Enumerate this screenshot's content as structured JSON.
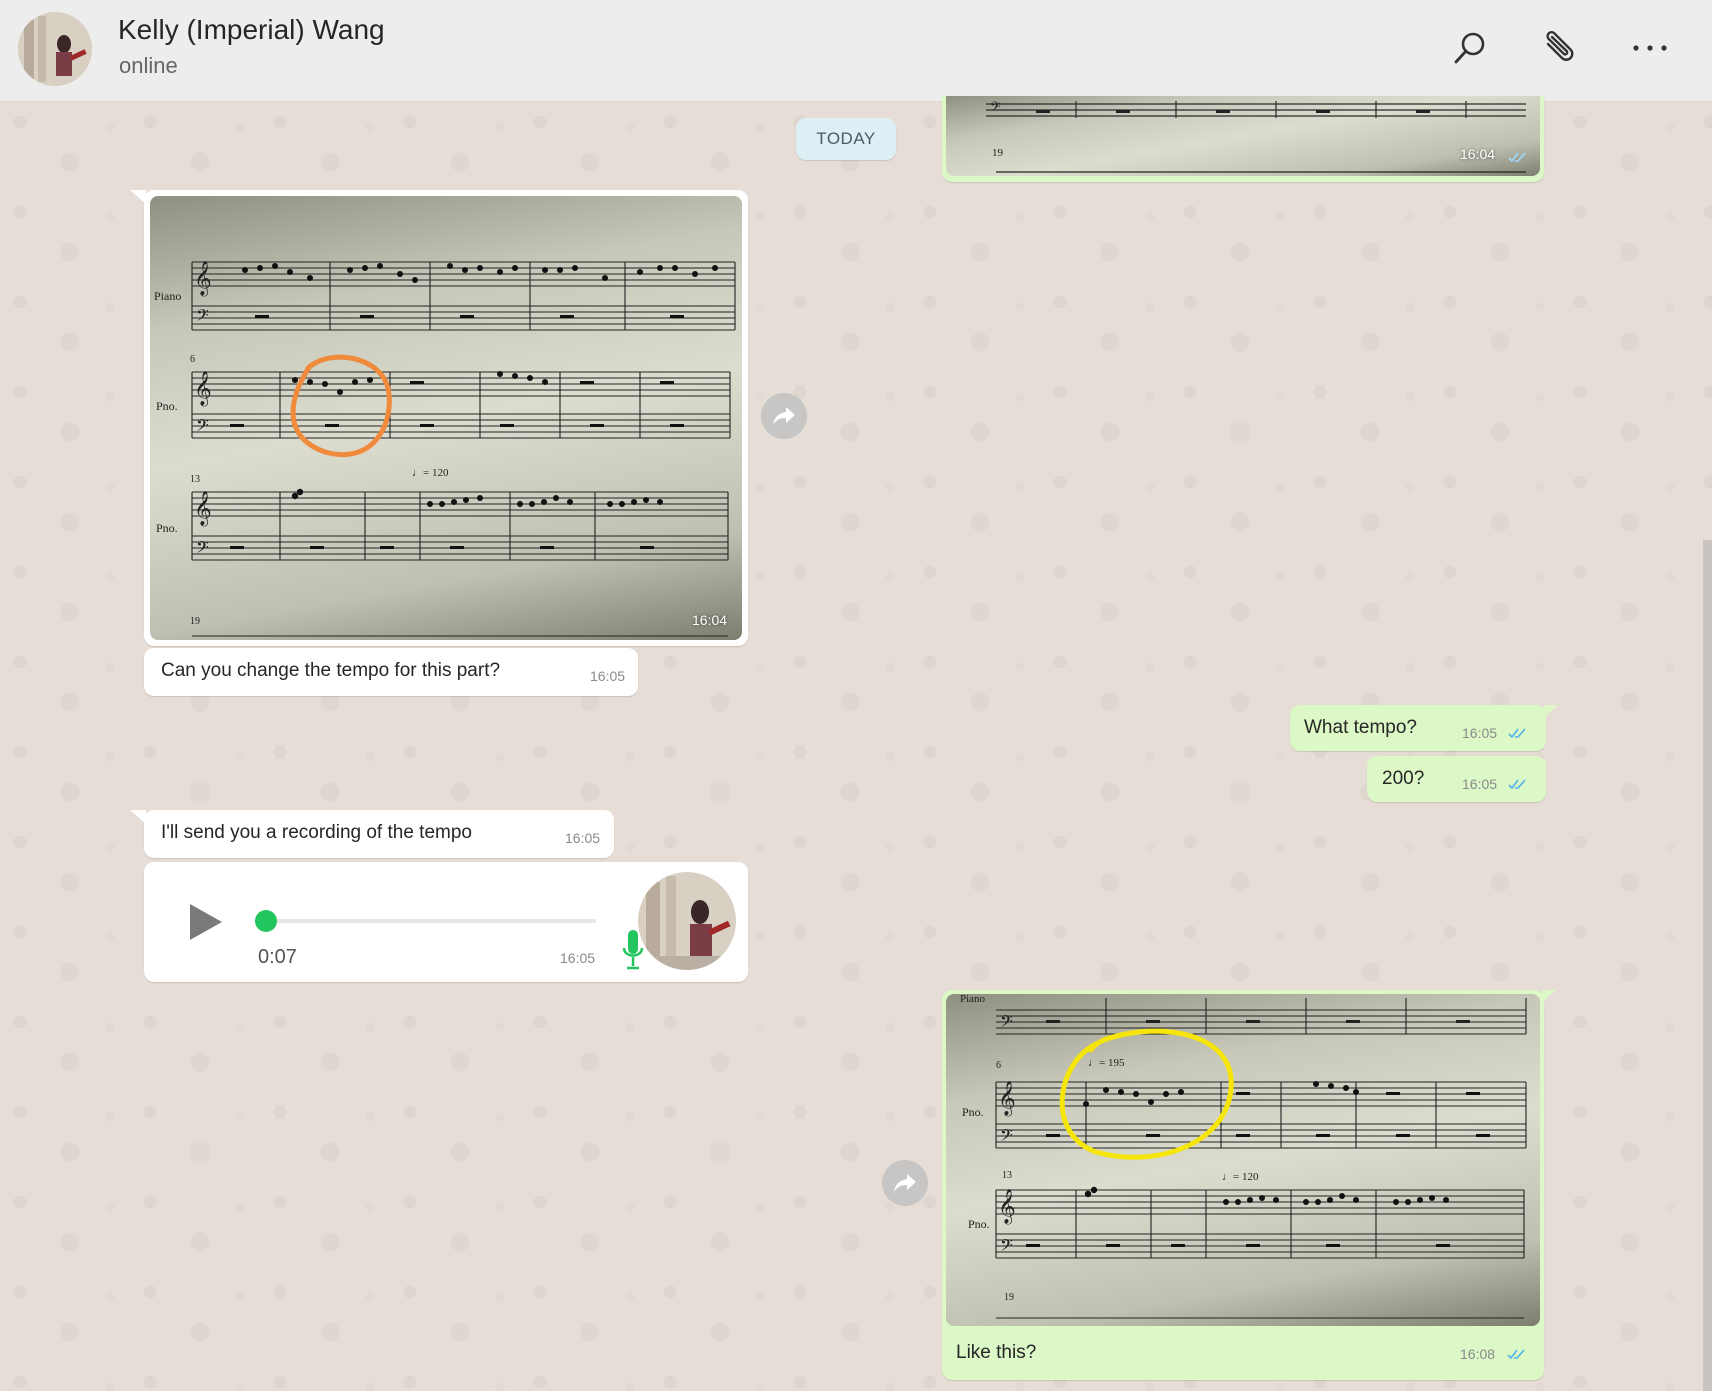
{
  "header": {
    "contact_name": "Kelly (Imperial) Wang",
    "contact_status": "online",
    "icons": [
      "search-icon",
      "attach-icon",
      "more-options-icon"
    ]
  },
  "date_divider": "TODAY",
  "messages": {
    "top_sent_image": {
      "time": "16:04",
      "sheet_measure": "19"
    },
    "received_image": {
      "time": "16:04",
      "sheet_labels": {
        "piano": "Piano",
        "pno1": "Pno.",
        "pno2": "Pno.",
        "m6": "6",
        "m13": "13",
        "m19": "19",
        "tempo": "♩= 120"
      }
    },
    "received_text_1": {
      "text": "Can you change the tempo for this part?",
      "time": "16:05"
    },
    "sent_text_1": {
      "text": "What tempo?",
      "time": "16:05"
    },
    "sent_text_2": {
      "text": "200?",
      "time": "16:05"
    },
    "received_text_2": {
      "text": "I'll send you a recording of the tempo",
      "time": "16:05"
    },
    "voice_note": {
      "duration": "0:07",
      "time": "16:05",
      "progress": 0
    },
    "sent_image": {
      "caption": "Like this?",
      "time": "16:08",
      "sheet_labels": {
        "piano": "Piano",
        "pno1": "Pno.",
        "pno2": "Pno.",
        "m6": "6",
        "m13": "13",
        "m19": "19",
        "tempo1": "♩= 195",
        "tempo2": "♩= 120"
      }
    }
  },
  "colors": {
    "incoming": "#ffffff",
    "outgoing": "#dcf8c6",
    "highlight_orange": "#f08a3c",
    "highlight_yellow": "#f5e50a",
    "read_ticks": "#4fb3e8"
  }
}
